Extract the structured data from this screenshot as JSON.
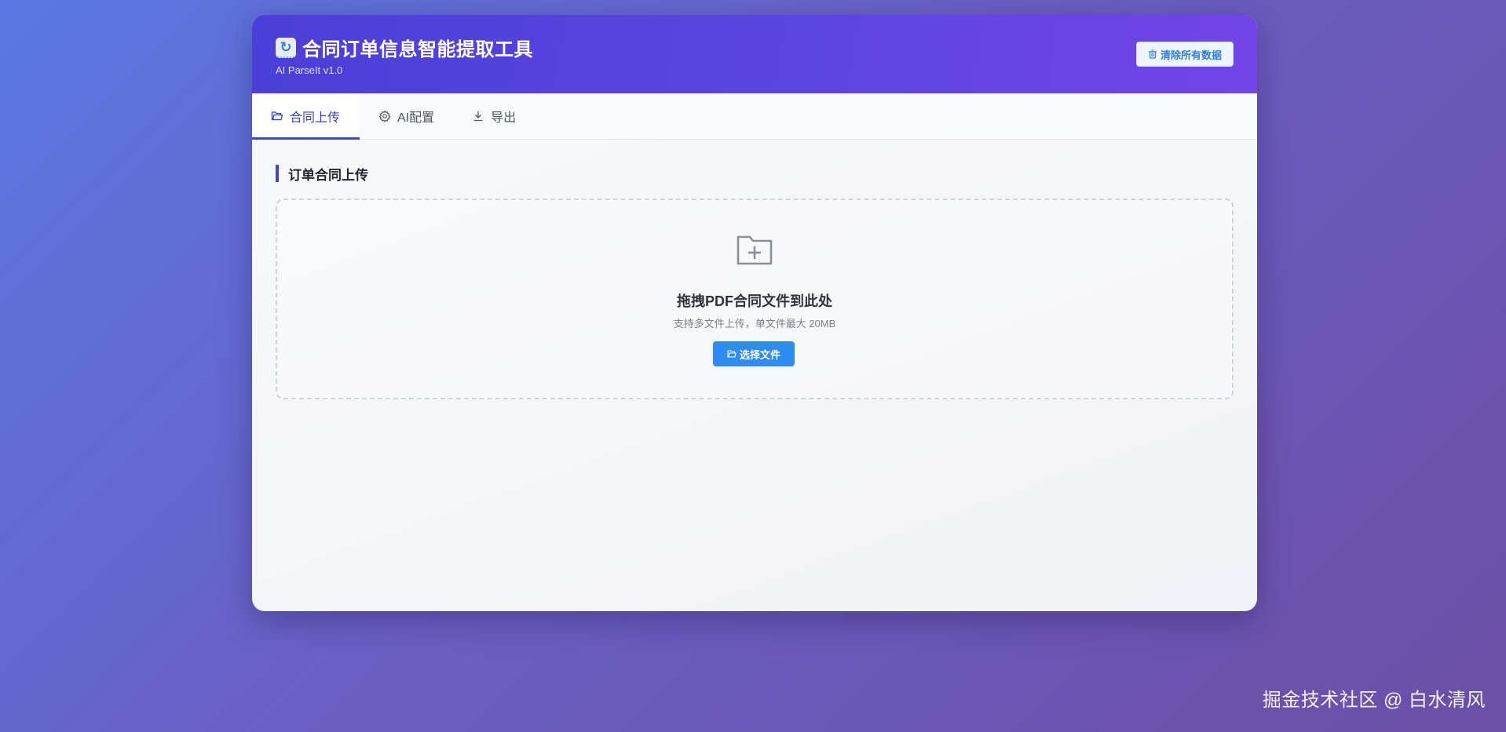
{
  "header": {
    "title": "合同订单信息智能提取工具",
    "subtitle": "AI ParseIt v1.0",
    "clear_button": "清除所有数据",
    "title_icon": "refresh-icon"
  },
  "tabs": [
    {
      "label": "合同上传",
      "icon": "folder-open-icon",
      "active": true
    },
    {
      "label": "AI配置",
      "icon": "gear-icon",
      "active": false
    },
    {
      "label": "导出",
      "icon": "download-icon",
      "active": false
    }
  ],
  "main": {
    "section_title": "订单合同上传",
    "dropzone": {
      "icon": "folder-plus-icon",
      "title": "拖拽PDF合同文件到此处",
      "hint": "支持多文件上传，单文件最大 20MB",
      "button": "选择文件"
    }
  },
  "watermark": "掘金技术社区 @ 白水清风",
  "colors": {
    "header_start": "#4a3fd8",
    "header_end": "#7245e6",
    "accent": "#3f46c8",
    "primary_button": "#2d8cf0"
  }
}
